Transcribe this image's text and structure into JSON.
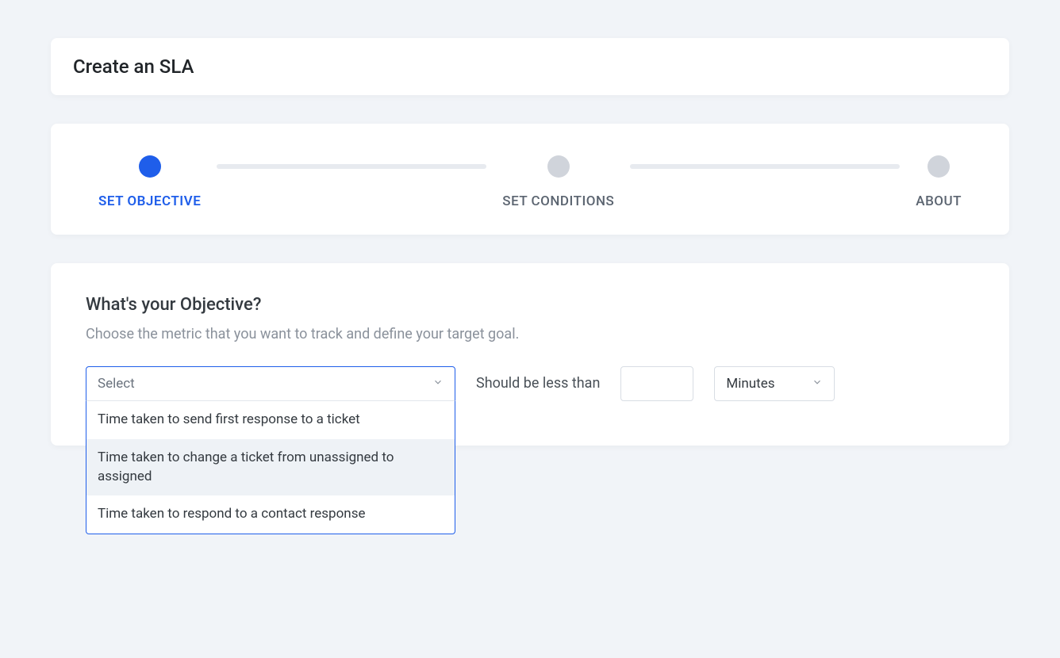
{
  "header": {
    "title": "Create an SLA"
  },
  "stepper": {
    "steps": [
      {
        "label": "SET OBJECTIVE",
        "active": true
      },
      {
        "label": "SET CONDITIONS",
        "active": false
      },
      {
        "label": "ABOUT",
        "active": false
      }
    ]
  },
  "objective": {
    "title": "What's your Objective?",
    "description": "Choose the metric that you want to track and define your target goal.",
    "metric_select": {
      "placeholder": "Select",
      "options": [
        "Time taken to send first response to a ticket",
        "Time taken to change a ticket from unassigned to assigned",
        "Time taken to respond to a contact response"
      ],
      "highlighted_index": 1
    },
    "threshold_label": "Should be less than",
    "value_input": "",
    "unit_select": {
      "value": "Minutes"
    }
  }
}
